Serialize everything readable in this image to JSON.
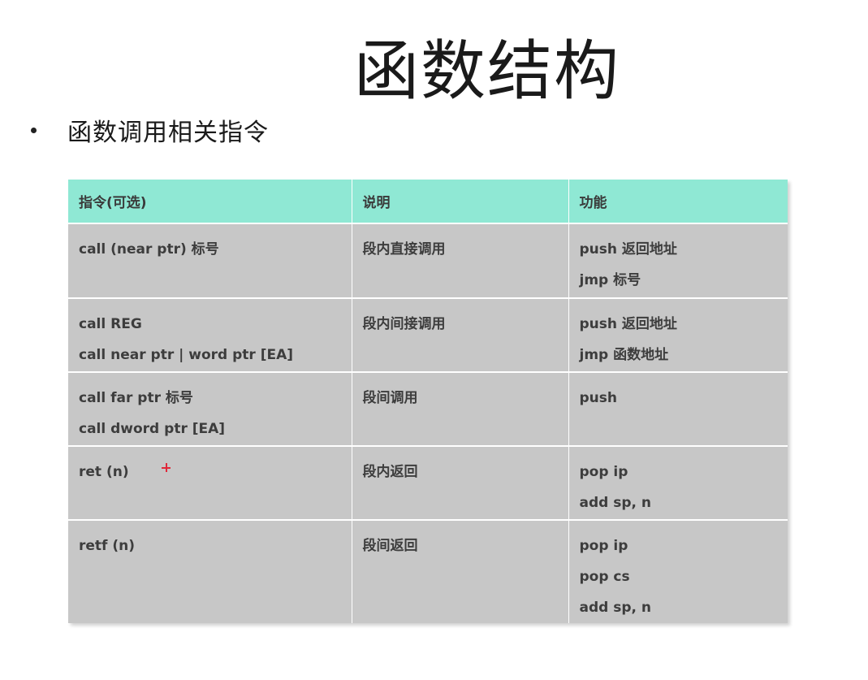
{
  "title": "函数结构",
  "bullet": "函数调用相关指令",
  "table": {
    "headers": [
      "指令(可选)",
      "说明",
      "功能"
    ],
    "rows": [
      {
        "instruction": [
          "call (near ptr) 标号"
        ],
        "description": "段内直接调用",
        "function": [
          "push 返回地址",
          "jmp 标号"
        ]
      },
      {
        "instruction": [
          "call REG",
          "call near ptr | word ptr [EA]"
        ],
        "description": "段内间接调用",
        "function": [
          "push 返回地址",
          "jmp 函数地址"
        ]
      },
      {
        "instruction": [
          "call far ptr 标号",
          "call dword ptr [EA]"
        ],
        "description": "段间调用",
        "function": [
          "push"
        ]
      },
      {
        "instruction": [
          "ret (n)"
        ],
        "description": "段内返回",
        "function": [
          "pop ip",
          "add sp, n"
        ]
      },
      {
        "instruction": [
          "retf (n)"
        ],
        "description": "段间返回",
        "function": [
          "pop ip",
          "pop cs",
          "add sp, n"
        ]
      }
    ]
  },
  "colors": {
    "header_bg": "#8fe8d4",
    "cell_bg": "#c7c7c7",
    "cursor": "#e0283a"
  }
}
